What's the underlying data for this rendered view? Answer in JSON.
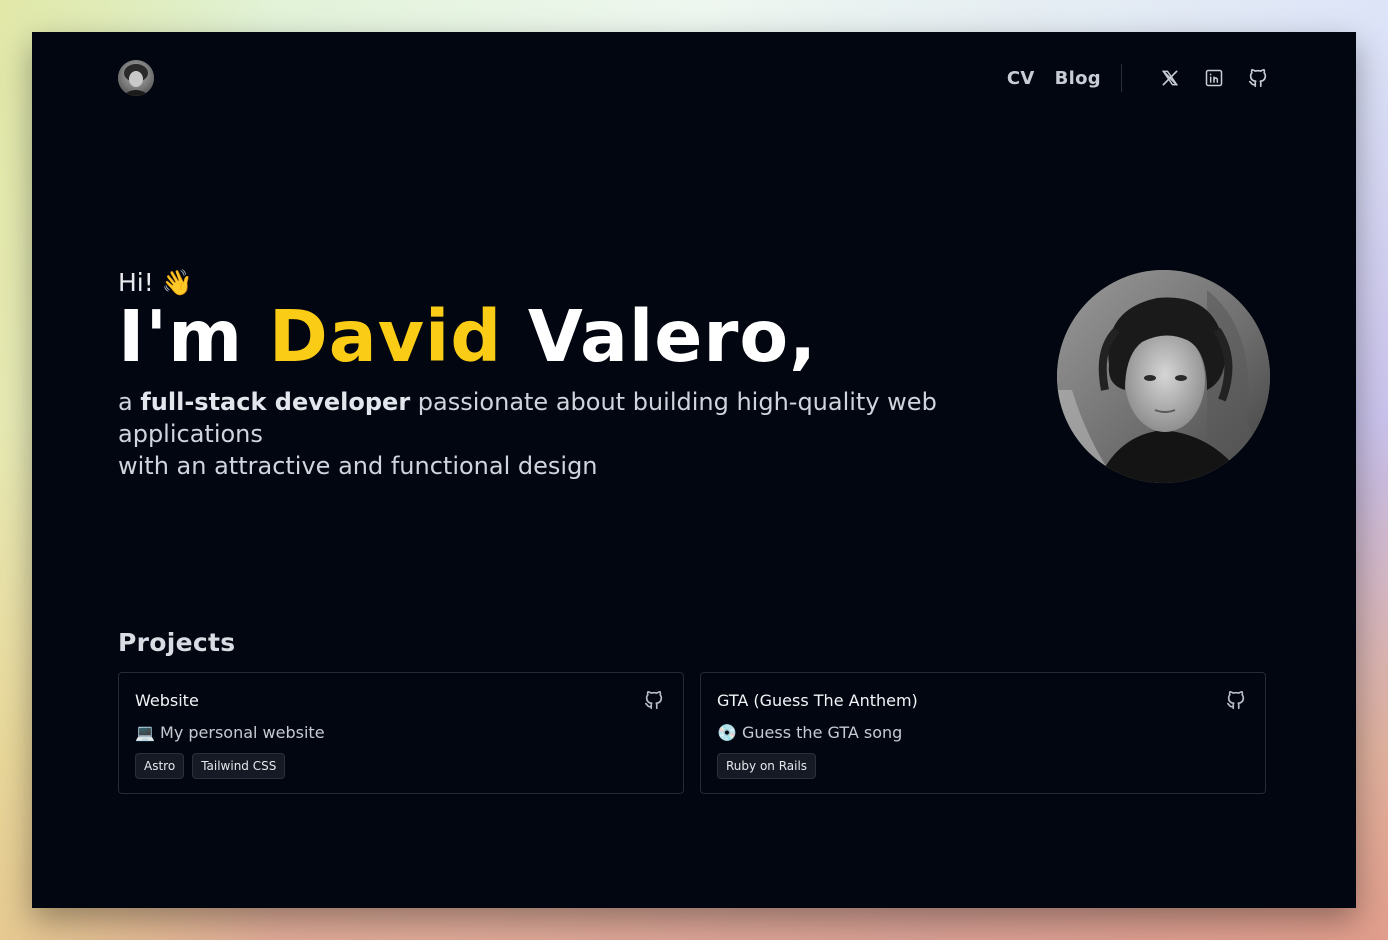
{
  "header": {
    "nav": [
      {
        "label": "CV"
      },
      {
        "label": "Blog"
      }
    ],
    "social_icons": [
      "x-twitter-icon",
      "linkedin-icon",
      "github-icon"
    ]
  },
  "hero": {
    "greeting": "Hi! 👋",
    "title_prefix": "I'm ",
    "title_accent": "David",
    "title_suffix": " Valero,",
    "subtitle_a": "a ",
    "subtitle_bold": "full-stack developer",
    "subtitle_rest": " passionate about building high-quality web applications",
    "subtitle_line2": "with an attractive and functional design"
  },
  "projects": {
    "title": "Projects",
    "items": [
      {
        "name": "Website",
        "description": "💻 My personal website",
        "tags": [
          "Astro",
          "Tailwind CSS"
        ]
      },
      {
        "name": "GTA (Guess The Anthem)",
        "description": "💿 Guess the GTA song",
        "tags": [
          "Ruby on Rails"
        ]
      }
    ]
  },
  "colors": {
    "background": "#020610",
    "accent": "#facc15",
    "text": "#ffffff"
  }
}
